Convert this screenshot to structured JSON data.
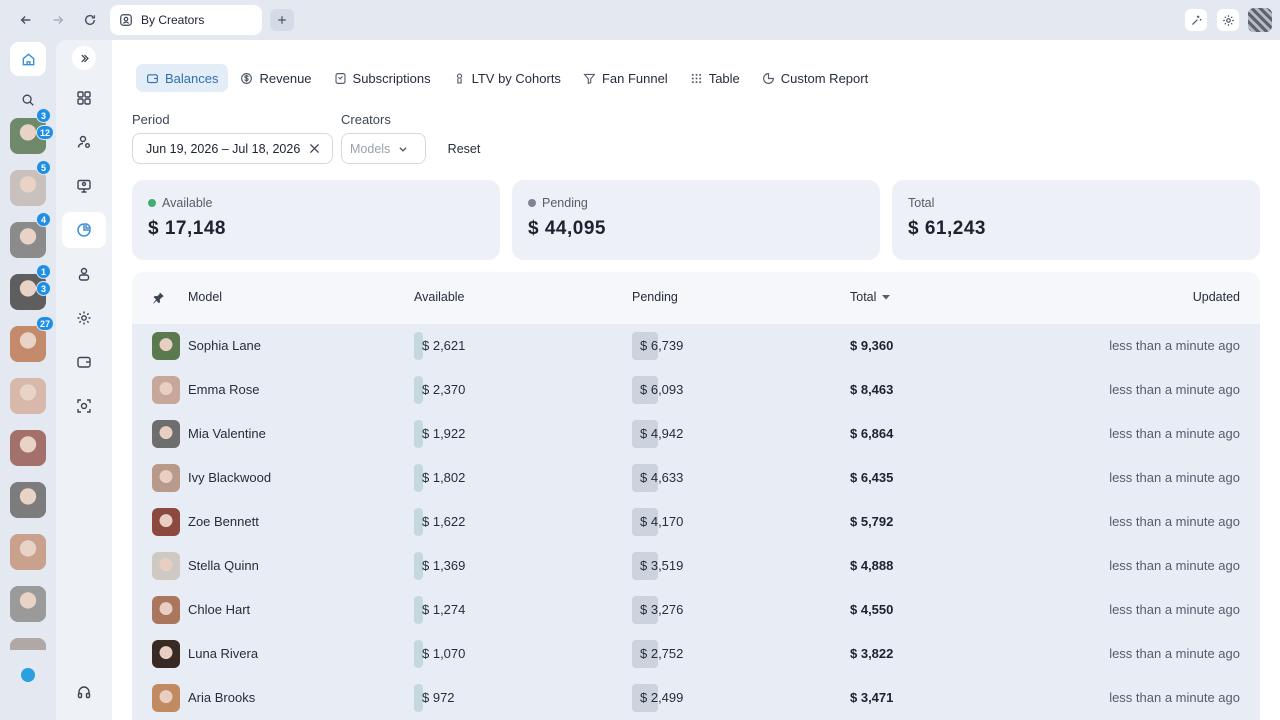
{
  "browser": {
    "tab_title": "By Creators"
  },
  "rail": {
    "creators": [
      {
        "badges": [
          "3",
          "12"
        ],
        "color": "#6f8a6a"
      },
      {
        "badges": [
          "5"
        ],
        "color": "#c9c1bd"
      },
      {
        "badges": [
          "4"
        ],
        "color": "#8b8b8b"
      },
      {
        "badges": [
          "1",
          "3"
        ],
        "color": "#5e5e5e"
      },
      {
        "badges": [
          "27"
        ],
        "color": "#c48a6c"
      },
      {
        "badges": [],
        "color": "#d7b8aa"
      },
      {
        "badges": [],
        "color": "#a4706a"
      },
      {
        "badges": [],
        "color": "#7c7c7c"
      },
      {
        "badges": [],
        "color": "#c9a18d"
      },
      {
        "badges": [],
        "color": "#9a9a9a"
      }
    ]
  },
  "report_tabs": [
    {
      "label": "Balances",
      "icon": "wallet-icon",
      "active": true
    },
    {
      "label": "Revenue",
      "icon": "dollar-circle-icon",
      "active": false
    },
    {
      "label": "Subscriptions",
      "icon": "subscriptions-icon",
      "active": false
    },
    {
      "label": "LTV by Cohorts",
      "icon": "ltv-icon",
      "active": false
    },
    {
      "label": "Fan Funnel",
      "icon": "funnel-icon",
      "active": false
    },
    {
      "label": "Table",
      "icon": "grid-icon",
      "active": false
    },
    {
      "label": "Custom Report",
      "icon": "pie-icon",
      "active": false
    }
  ],
  "filters": {
    "period_label": "Period",
    "period_value": "Jun 19, 2026 – Jul 18, 2026",
    "creators_label": "Creators",
    "creators_placeholder": "Models",
    "reset_label": "Reset"
  },
  "summary": {
    "available": {
      "label": "Available",
      "value": "$ 17,148",
      "dot_color": "#3fae74"
    },
    "pending": {
      "label": "Pending",
      "value": "$ 44,095",
      "dot_color": "#7d8594"
    },
    "total": {
      "label": "Total",
      "value": "$ 61,243"
    }
  },
  "table": {
    "columns": {
      "model": "Model",
      "available": "Available",
      "pending": "Pending",
      "total": "Total",
      "updated": "Updated"
    },
    "rows": [
      {
        "name": "Sophia Lane",
        "available": "$ 2,621",
        "available_share": 0.28,
        "pending": "$ 6,739",
        "pending_share": 0.72,
        "total": "$ 9,360",
        "updated": "less than a minute ago",
        "avatar_color": "#5a7a4e"
      },
      {
        "name": "Emma Rose",
        "available": "$ 2,370",
        "available_share": 0.28,
        "pending": "$ 6,093",
        "pending_share": 0.72,
        "total": "$ 8,463",
        "updated": "less than a minute ago",
        "avatar_color": "#c7a79a"
      },
      {
        "name": "Mia Valentine",
        "available": "$ 1,922",
        "available_share": 0.28,
        "pending": "$ 4,942",
        "pending_share": 0.72,
        "total": "$ 6,864",
        "updated": "less than a minute ago",
        "avatar_color": "#6e6e6e"
      },
      {
        "name": "Ivy Blackwood",
        "available": "$ 1,802",
        "available_share": 0.28,
        "pending": "$ 4,633",
        "pending_share": 0.72,
        "total": "$ 6,435",
        "updated": "less than a minute ago",
        "avatar_color": "#b9998a"
      },
      {
        "name": "Zoe Bennett",
        "available": "$ 1,622",
        "available_share": 0.28,
        "pending": "$ 4,170",
        "pending_share": 0.72,
        "total": "$ 5,792",
        "updated": "less than a minute ago",
        "avatar_color": "#8c4a3e"
      },
      {
        "name": "Stella Quinn",
        "available": "$ 1,369",
        "available_share": 0.28,
        "pending": "$ 3,519",
        "pending_share": 0.72,
        "total": "$ 4,888",
        "updated": "less than a minute ago",
        "avatar_color": "#cfc9c4"
      },
      {
        "name": "Chloe Hart",
        "available": "$ 1,274",
        "available_share": 0.28,
        "pending": "$ 3,276",
        "pending_share": 0.72,
        "total": "$ 4,550",
        "updated": "less than a minute ago",
        "avatar_color": "#a9765e"
      },
      {
        "name": "Luna Rivera",
        "available": "$ 1,070",
        "available_share": 0.28,
        "pending": "$ 2,752",
        "pending_share": 0.72,
        "total": "$ 3,822",
        "updated": "less than a minute ago",
        "avatar_color": "#3a2a24"
      },
      {
        "name": "Aria Brooks",
        "available": "$ 972",
        "available_share": 0.28,
        "pending": "$ 2,499",
        "pending_share": 0.72,
        "total": "$ 3,471",
        "updated": "less than a minute ago",
        "avatar_color": "#c28a60"
      }
    ]
  }
}
